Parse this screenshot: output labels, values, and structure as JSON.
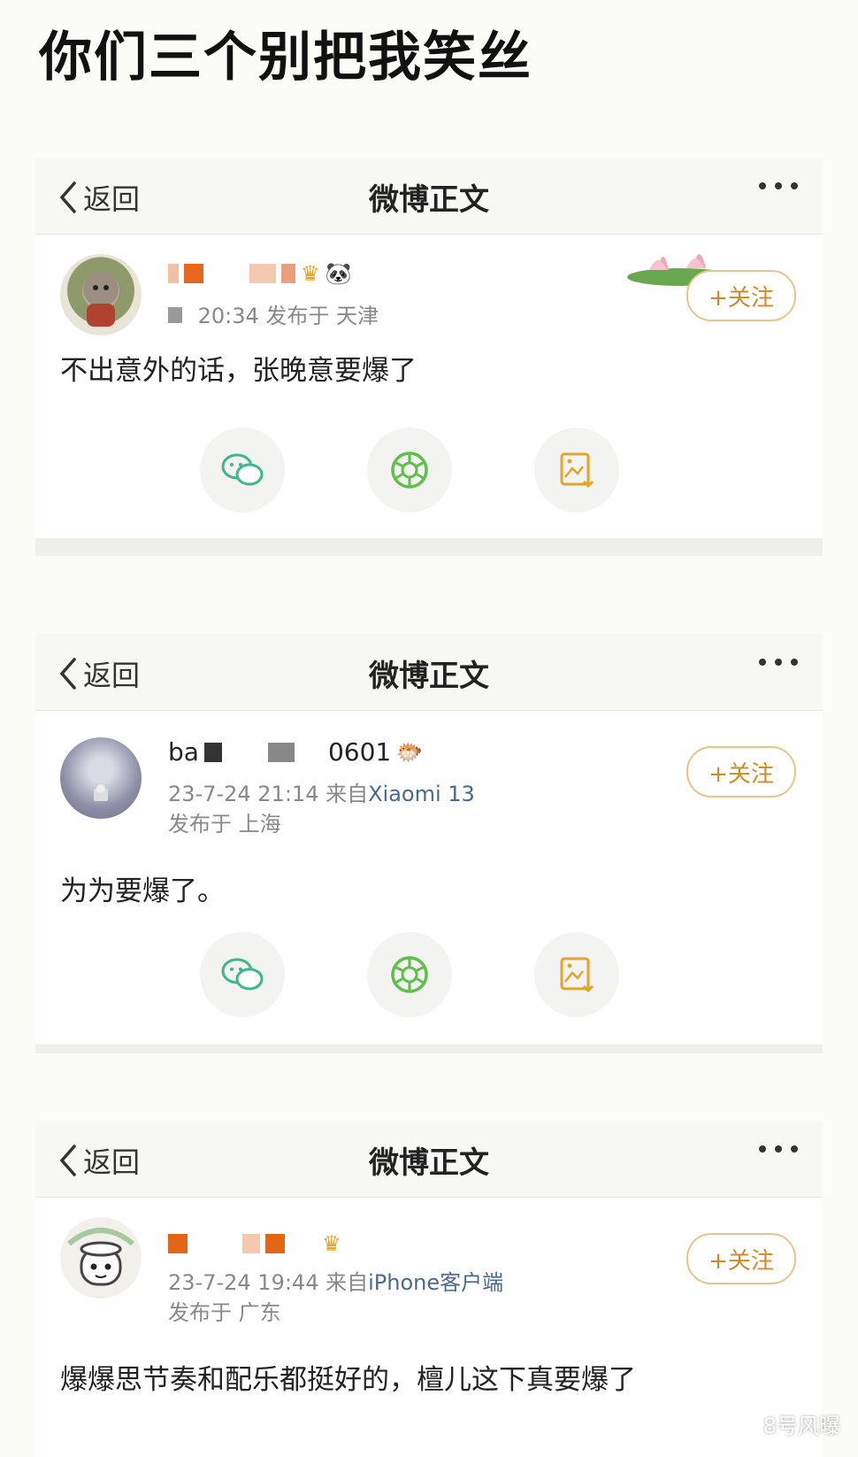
{
  "headline": "你们三个别把我笑丝",
  "nav": {
    "back_label": "返回",
    "title": "微博正文"
  },
  "follow_label": "+关注",
  "posts": [
    {
      "username_visible": "",
      "meta_line1": "20:34 发布于 天津",
      "content": "不出意外的话，张晚意要爆了"
    },
    {
      "username_visible": "ba 0601",
      "meta_time": "23-7-24 21:14",
      "meta_source_prefix": "来自",
      "meta_source": "Xiaomi 13",
      "meta_location": "发布于 上海",
      "content": "为为要爆了。"
    },
    {
      "username_visible": "",
      "meta_time": "23-7-24 19:44",
      "meta_source_prefix": "来自",
      "meta_source": "iPhone客户端",
      "meta_location": "发布于 广东",
      "content": "爆爆思节奏和配乐都挺好的，檀儿这下真要爆了"
    }
  ],
  "icons": [
    "back-chevron-icon",
    "more-icon",
    "wechat-icon",
    "moments-icon",
    "save-image-icon"
  ],
  "colors": {
    "follow": "#c98b2e",
    "wechat": "#3cb88a",
    "moments": "#5fbf4a",
    "save": "#e0a52a"
  },
  "watermark": "8号风曝"
}
